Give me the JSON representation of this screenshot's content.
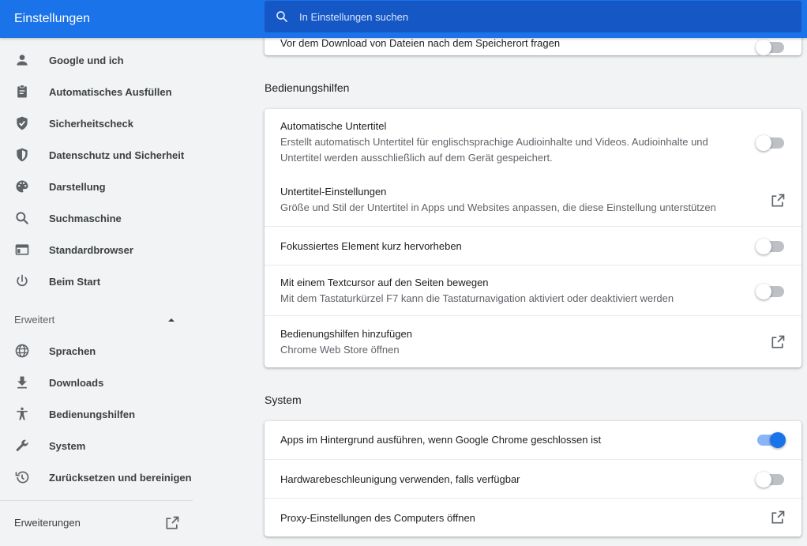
{
  "header": {
    "title": "Einstellungen",
    "search_placeholder": "In Einstellungen suchen"
  },
  "sidebar": {
    "items": [
      {
        "label": "Google und ich",
        "icon": "person-icon"
      },
      {
        "label": "Automatisches Ausfüllen",
        "icon": "clipboard-icon"
      },
      {
        "label": "Sicherheitscheck",
        "icon": "shield-check-icon"
      },
      {
        "label": "Datenschutz und Sicherheit",
        "icon": "shield-half-icon"
      },
      {
        "label": "Darstellung",
        "icon": "palette-icon"
      },
      {
        "label": "Suchmaschine",
        "icon": "search-icon"
      },
      {
        "label": "Standardbrowser",
        "icon": "browser-window-icon"
      },
      {
        "label": "Beim Start",
        "icon": "power-icon"
      }
    ],
    "advanced_label": "Erweitert",
    "advanced_items": [
      {
        "label": "Sprachen",
        "icon": "globe-icon"
      },
      {
        "label": "Downloads",
        "icon": "download-icon"
      },
      {
        "label": "Bedienungshilfen",
        "icon": "accessibility-icon"
      },
      {
        "label": "System",
        "icon": "wrench-icon"
      },
      {
        "label": "Zurücksetzen und bereinigen",
        "icon": "history-icon"
      }
    ],
    "extensions_label": "Erweiterungen"
  },
  "main": {
    "top_partial_text": "Vor dem Download von Dateien nach dem Speicherort fragen",
    "accessibility": {
      "title": "Bedienungshilfen",
      "rows": [
        {
          "title": "Automatische Untertitel",
          "sub": "Erstellt automatisch Untertitel für englischsprachige Audioinhalte und Videos. Audioinhalte und Untertitel werden ausschließlich auf dem Gerät gespeichert.",
          "control": "toggle",
          "on": false
        },
        {
          "title": "Untertitel-Einstellungen",
          "sub": "Größe und Stil der Untertitel in Apps und Websites anpassen, die diese Einstellung unterstützen",
          "control": "external-link"
        },
        {
          "title": "Fokussiertes Element kurz hervorheben",
          "control": "toggle",
          "on": false
        },
        {
          "title": "Mit einem Textcursor auf den Seiten bewegen",
          "sub": "Mit dem Tastaturkürzel F7 kann die Tastaturnavigation aktiviert oder deaktiviert werden",
          "control": "toggle",
          "on": false
        },
        {
          "title": "Bedienungshilfen hinzufügen",
          "sub": "Chrome Web Store öffnen",
          "control": "external-link"
        }
      ]
    },
    "system": {
      "title": "System",
      "rows": [
        {
          "title": "Apps im Hintergrund ausführen, wenn Google Chrome geschlossen ist",
          "control": "toggle",
          "on": true
        },
        {
          "title": "Hardwarebeschleunigung verwenden, falls verfügbar",
          "control": "toggle",
          "on": false
        },
        {
          "title": "Proxy-Einstellungen des Computers öffnen",
          "control": "external-link"
        }
      ]
    }
  },
  "colors": {
    "accent": "#1a73e8",
    "background": "#f1f3f4",
    "icon": "#5f6368"
  }
}
